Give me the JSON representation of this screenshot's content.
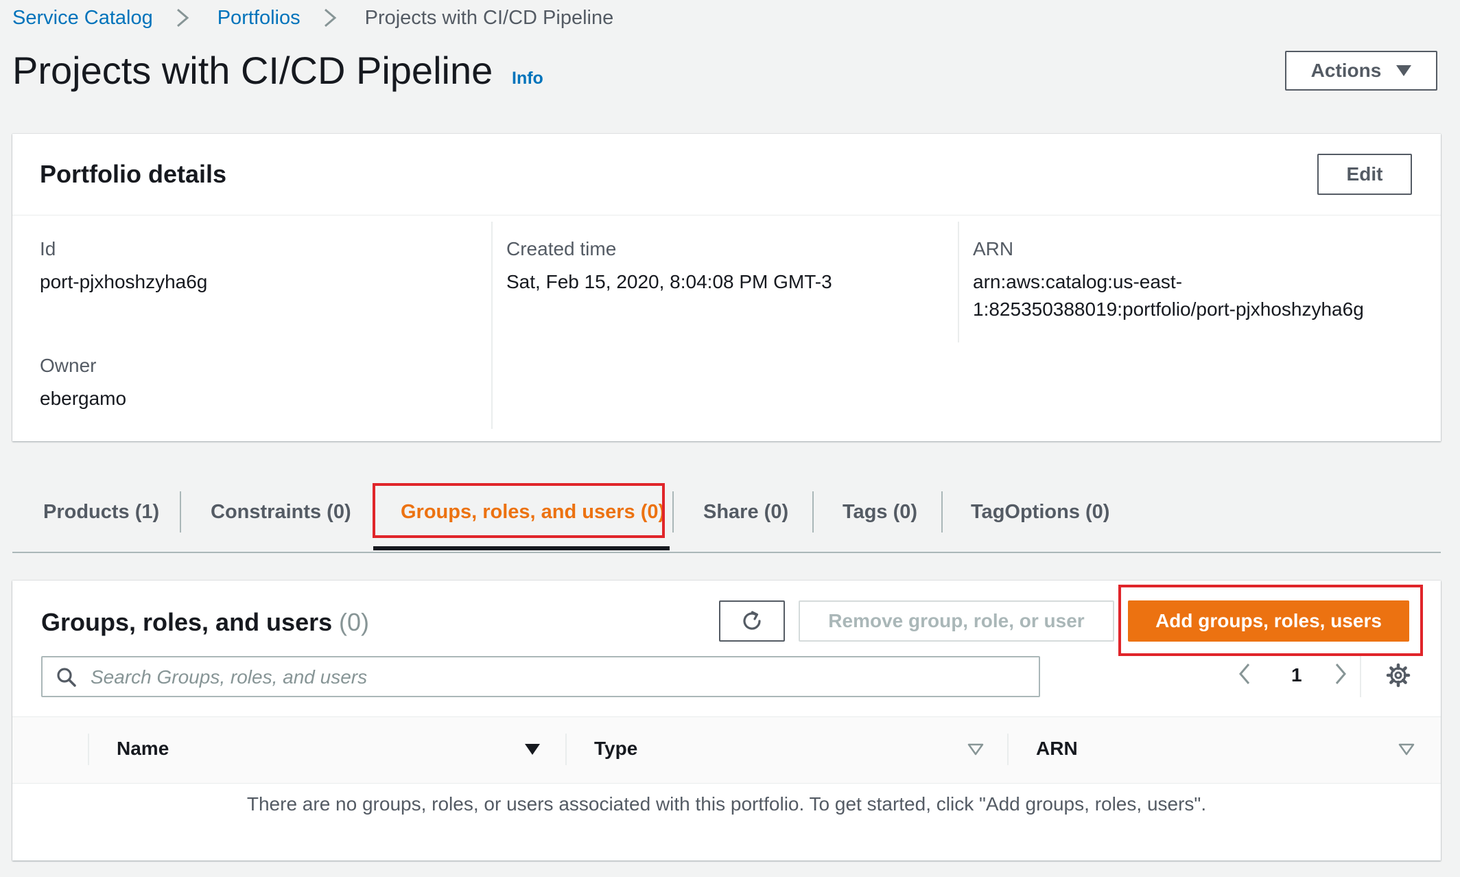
{
  "breadcrumb": {
    "items": [
      "Service Catalog",
      "Portfolios"
    ],
    "current": "Projects with CI/CD Pipeline"
  },
  "header": {
    "title": "Projects with CI/CD Pipeline",
    "info": "Info",
    "actions_label": "Actions"
  },
  "portfolio_details": {
    "title": "Portfolio details",
    "edit_label": "Edit",
    "id_label": "Id",
    "id_value": "port-pjxhoshzyha6g",
    "owner_label": "Owner",
    "owner_value": "ebergamo",
    "created_label": "Created time",
    "created_value": "Sat, Feb 15, 2020, 8:04:08 PM GMT-3",
    "arn_label": "ARN",
    "arn_line1": "arn:aws:catalog:us-east-",
    "arn_line2": "1:825350388019:portfolio/port-pjxhoshzyha6g"
  },
  "tabs": [
    {
      "label": "Products (1)"
    },
    {
      "label": "Constraints (0)"
    },
    {
      "label": "Groups, roles, and users (0)",
      "active": true
    },
    {
      "label": "Share (0)"
    },
    {
      "label": "Tags (0)"
    },
    {
      "label": "TagOptions (0)"
    }
  ],
  "groups": {
    "title": "Groups, roles, and users",
    "count": "(0)",
    "remove_label": "Remove group, role, or user",
    "add_label": "Add groups, roles, users",
    "search_placeholder": "Search Groups, roles, and users",
    "page": "1",
    "columns": [
      "Name",
      "Type",
      "ARN"
    ],
    "empty_message": "There are no groups, roles, or users associated with this portfolio. To get started, click \"Add groups, roles, users\"."
  },
  "colors": {
    "link": "#0073bb",
    "accent": "#ec7211",
    "highlight": "#e0252a"
  },
  "icons": [
    "chevron-right-icon",
    "caret-down-icon",
    "refresh-icon",
    "search-icon",
    "chevron-left-icon",
    "gear-icon",
    "sort-icon"
  ]
}
